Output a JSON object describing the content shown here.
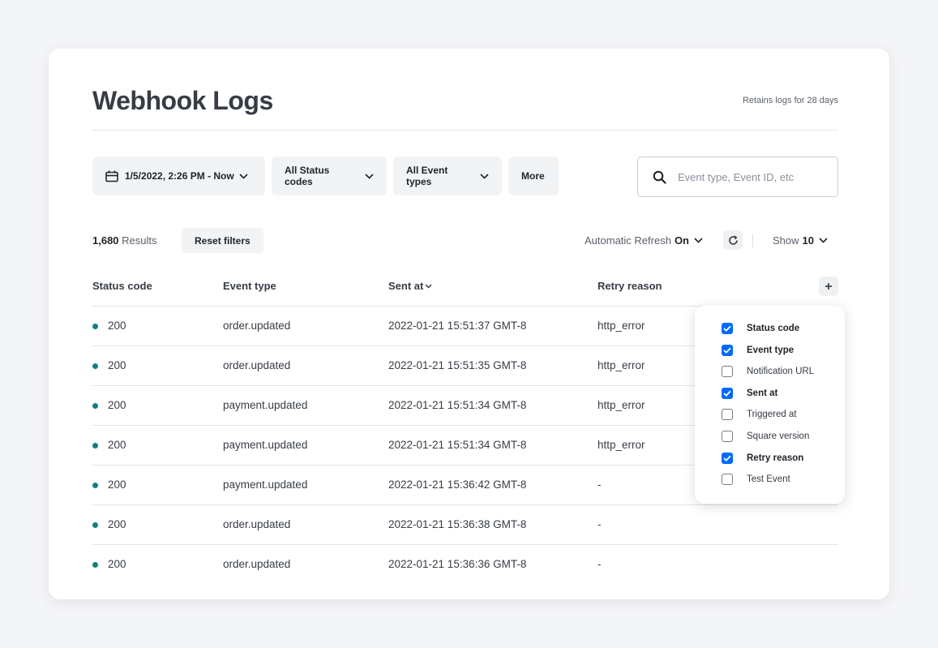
{
  "page": {
    "title": "Webhook Logs",
    "retention_note": "Retains logs for 28 days"
  },
  "filters": {
    "date_range": "1/5/2022, 2:26 PM - Now",
    "status_codes": "All Status codes",
    "event_types": "All Event types",
    "more": "More"
  },
  "search": {
    "placeholder": "Event type, Event ID, etc",
    "value": ""
  },
  "summary": {
    "count": "1,680",
    "results_label": "Results",
    "reset_label": "Reset filters",
    "auto_refresh_label": "Automatic Refresh",
    "auto_refresh_value": "On",
    "show_label": "Show",
    "show_value": "10"
  },
  "table": {
    "columns": [
      "Status code",
      "Event type",
      "Sent at",
      "Retry reason"
    ],
    "rows": [
      {
        "status": "200",
        "event": "order.updated",
        "sent_at": "2022-01-21 15:51:37 GMT-8",
        "retry": "http_error"
      },
      {
        "status": "200",
        "event": "order.updated",
        "sent_at": "2022-01-21 15:51:35 GMT-8",
        "retry": "http_error"
      },
      {
        "status": "200",
        "event": "payment.updated",
        "sent_at": "2022-01-21 15:51:34 GMT-8",
        "retry": "http_error"
      },
      {
        "status": "200",
        "event": "payment.updated",
        "sent_at": "2022-01-21 15:51:34 GMT-8",
        "retry": "http_error"
      },
      {
        "status": "200",
        "event": "payment.updated",
        "sent_at": "2022-01-21 15:36:42 GMT-8",
        "retry": "-"
      },
      {
        "status": "200",
        "event": "order.updated",
        "sent_at": "2022-01-21 15:36:38 GMT-8",
        "retry": "-"
      },
      {
        "status": "200",
        "event": "order.updated",
        "sent_at": "2022-01-21 15:36:36 GMT-8",
        "retry": "-"
      }
    ]
  },
  "column_menu": {
    "options": [
      {
        "label": "Status code",
        "checked": true
      },
      {
        "label": "Event type",
        "checked": true
      },
      {
        "label": "Notification URL",
        "checked": false
      },
      {
        "label": "Sent at",
        "checked": true
      },
      {
        "label": "Triggered at",
        "checked": false
      },
      {
        "label": "Square version",
        "checked": false
      },
      {
        "label": "Retry reason",
        "checked": true
      },
      {
        "label": "Test Event",
        "checked": false
      }
    ]
  },
  "colors": {
    "accent": "#006aff",
    "status_ok": "#118080",
    "title": "#373c45"
  },
  "icons": [
    "calendar-icon",
    "chevron-down-icon",
    "search-icon",
    "refresh-icon",
    "plus-icon",
    "sort-chevron-icon",
    "checkmark-icon"
  ]
}
